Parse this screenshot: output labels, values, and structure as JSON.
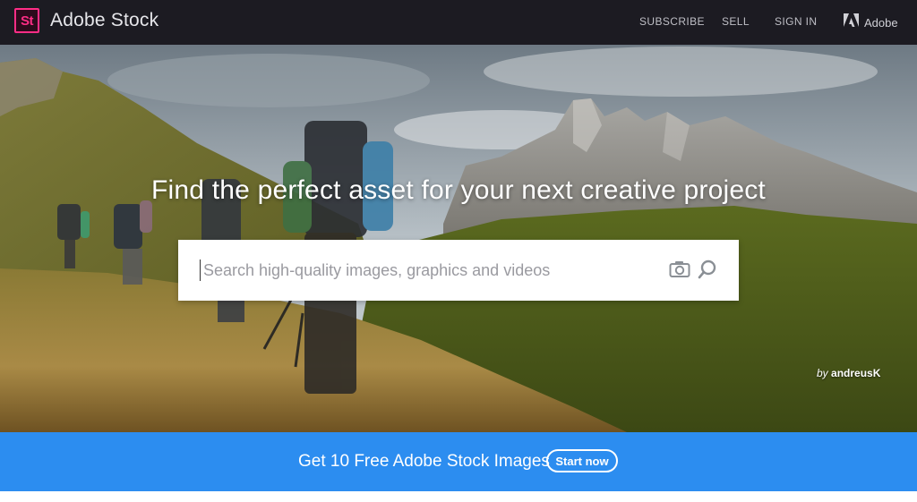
{
  "header": {
    "logo_text": "St",
    "brand": "Adobe Stock",
    "nav": {
      "subscribe": "SUBSCRIBE",
      "sell": "SELL",
      "sign_in": "SIGN IN",
      "adobe": "Adobe"
    },
    "icons": {
      "adobe_logo": "adobe-logo-icon"
    },
    "colors": {
      "background": "#1c1b22",
      "logo_accent": "#ff2d86"
    }
  },
  "hero": {
    "headline": "Find the perfect asset for your next creative project",
    "search": {
      "placeholder": "Search high-quality images, graphics and videos",
      "value": ""
    },
    "icons": {
      "visual_search": "camera-icon",
      "submit": "search-icon"
    },
    "credit": {
      "prefix": "by",
      "author": "andreusK"
    }
  },
  "promo": {
    "text": "Get 10 Free Adobe Stock Images",
    "button": "Start now",
    "color": "#2c8df0"
  }
}
